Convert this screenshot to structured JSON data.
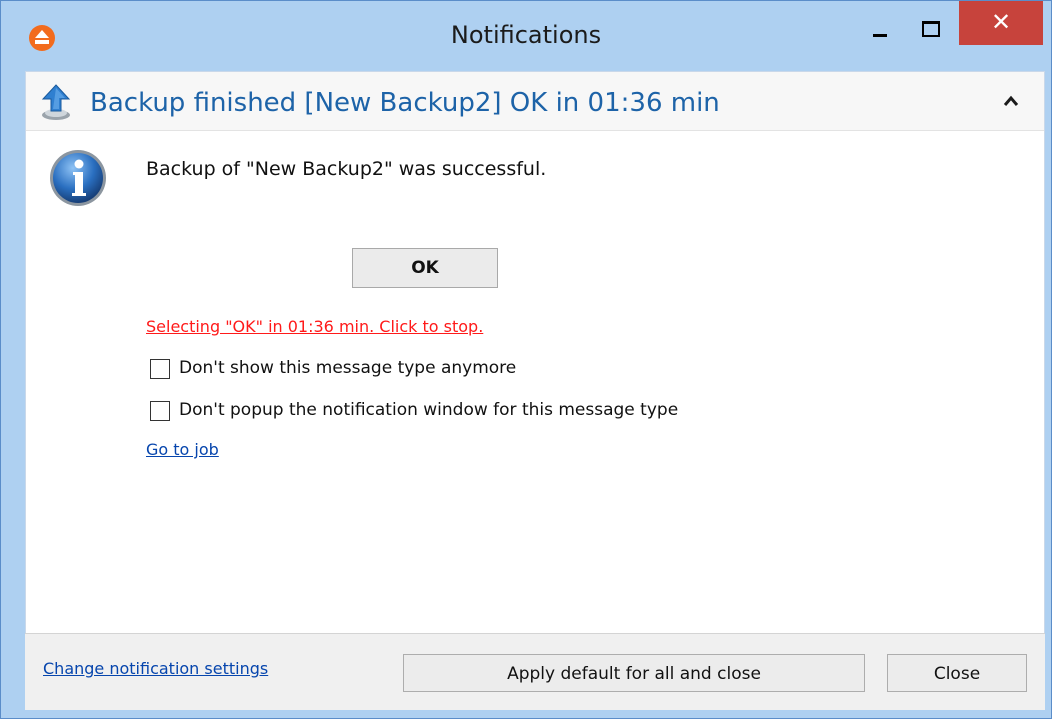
{
  "window": {
    "title": "Notifications",
    "app_icon": "app-backup-icon",
    "controls": {
      "minimize_icon": "minimize-icon",
      "maximize_icon": "maximize-icon",
      "close_glyph": "✕"
    }
  },
  "notification": {
    "header_icon": "upload-icon",
    "title": "Backup finished [New Backup2] OK in 01:36 min",
    "collapse_icon": "chevron-up-icon",
    "body_icon": "info-icon",
    "message": "Backup of \"New Backup2\" was successful.",
    "ok_label": "OK",
    "auto_select_text": "Selecting \"OK\" in 01:36 min. Click to stop.",
    "checkboxes": [
      {
        "label": "Don't show this message type anymore",
        "checked": false
      },
      {
        "label": "Don't popup the notification window for this message type",
        "checked": false
      }
    ],
    "go_to_job_label": "Go to job"
  },
  "footer": {
    "settings_link": "Change notification settings",
    "apply_label": "Apply default for all and close",
    "close_label": "Close"
  },
  "colors": {
    "frame": "#aed0f1",
    "title_accent": "#1d63a8",
    "close_button": "#c7433c",
    "warning_link": "#ff1a1a",
    "link": "#0645ad"
  }
}
